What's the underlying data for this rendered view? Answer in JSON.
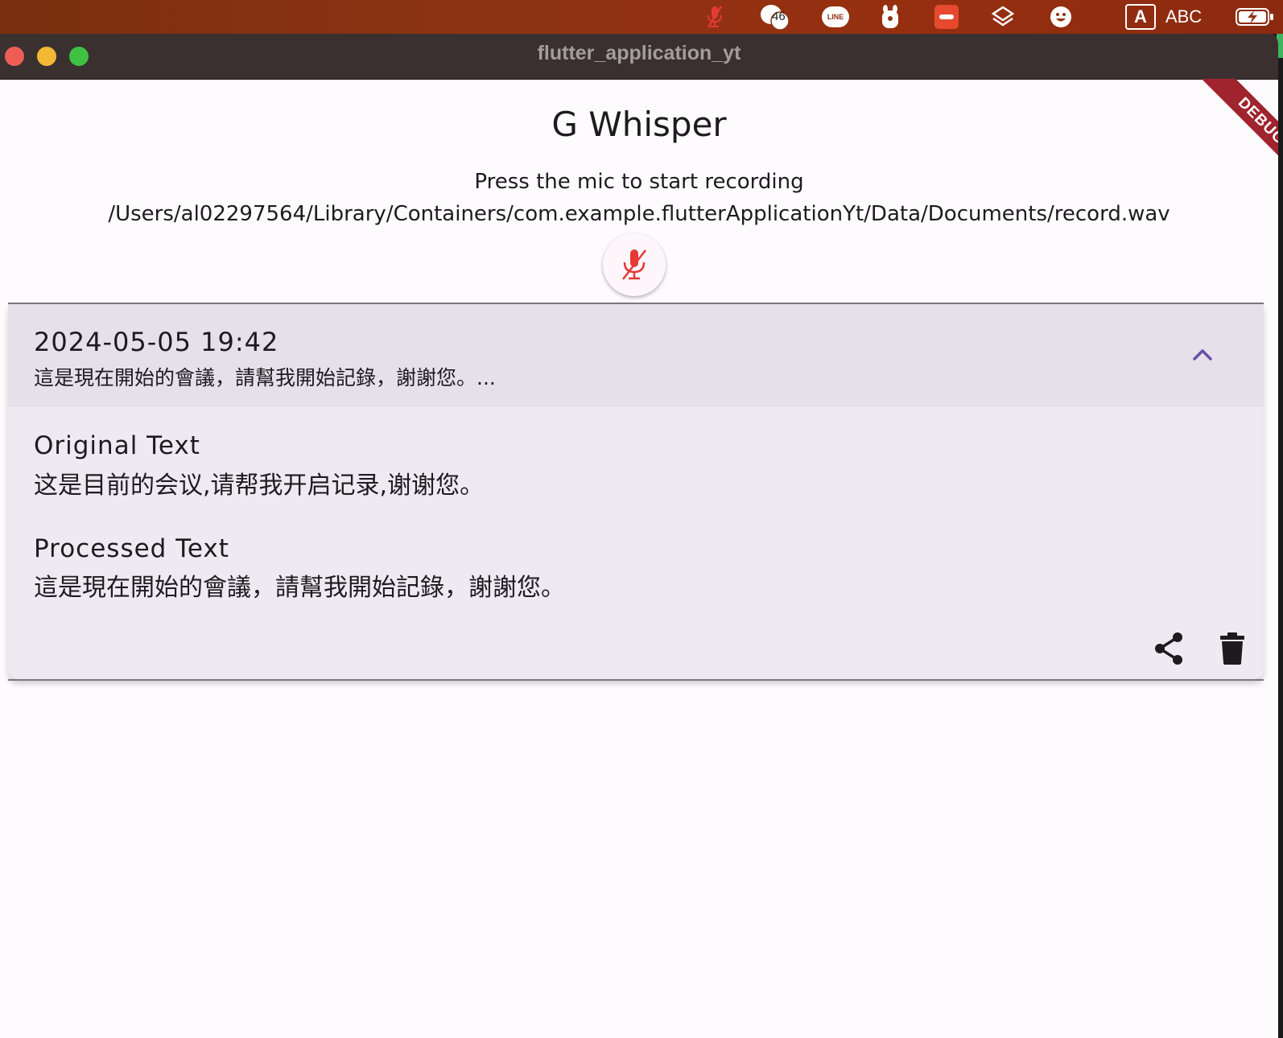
{
  "menubar": {
    "notification_count": "46",
    "line_label": "LINE",
    "input_badge": "A",
    "input_source": "ABC"
  },
  "window": {
    "title": "flutter_application_yt",
    "debug_banner": "DEBUG"
  },
  "app": {
    "title": "G Whisper",
    "status_line": "Press the mic to start recording",
    "file_path": "/Users/al02297564/Library/Containers/com.example.flutterApplicationYt/Data/Documents/record.wav"
  },
  "recording": {
    "date": "2024-05-05 19:42",
    "preview": "這是現在開始的會議，請幫我開始記錄，謝謝您。...",
    "original_label": "Original Text",
    "original_text": "这是目前的会议,请帮我开启记录,谢谢您。",
    "processed_label": "Processed Text",
    "processed_text": "這是現在開始的會議，請幫我開始記錄，謝謝您。"
  },
  "icons": {
    "mic": "mic-off-icon",
    "expand": "chevron-up-icon",
    "share": "share-icon",
    "delete": "trash-icon"
  },
  "colors": {
    "accent": "#6750a4",
    "mic_red": "#e53935",
    "card_bg": "#efe9f2",
    "card_header_bg": "#e5e0ea",
    "debug_red": "#a0242d"
  }
}
